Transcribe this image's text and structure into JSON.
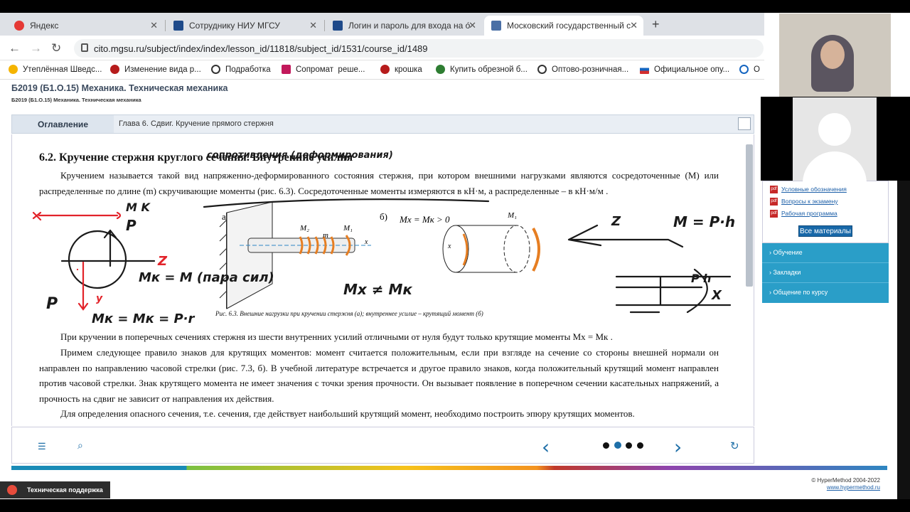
{
  "browser": {
    "tabs": [
      {
        "label": "Яндекс",
        "color": "#e53935"
      },
      {
        "label": "Сотруднику НИУ МГСУ",
        "color": "#1e4a8a"
      },
      {
        "label": "Логин и пароль для входа на о́",
        "color": "#1e4a8a"
      },
      {
        "label": "Московский государственный с",
        "color": "#4a6fa5"
      }
    ],
    "url": "cito.mgsu.ru/subject/index/index/lesson_id/11818/subject_id/1531/course_id/1489",
    "bookmarks": [
      "Утеплённая Шведс...",
      "Изменение вида р...",
      "Подработка",
      "Сопромат ⁣ реше...",
      "крошка",
      "Купить обрезной б...",
      "Оптово-розничная...",
      "Официальное опу...",
      "О"
    ]
  },
  "page": {
    "course_title": "Б2019 (Б1.О.15) Механика. Техническая механика",
    "course_subtitle": "Б2019 (Б1.О.15) Механика. Техническая механика",
    "toc_label": "Оглавление",
    "chapter": "Глава 6. Сдвиг. Кручение прямого стержня",
    "section_heading": "6.2. Кручение стержня круглого сечения. Внутренние усилия",
    "para1": "Кручением называется такой вид напряженно-деформированного состояния стержня, при котором внешними нагрузками являются сосредоточенные (M) или распределенные по длине (m) скручивающие моменты (рис. 6.3). Сосредоточенные моменты измеряются в кН·м, а распределенные – в кН·м/м .",
    "caption": "Рис. 6.3. Внешние нагрузки при кручении стержня (а); внутреннее усилие – крутящий момент (б)",
    "para2": "При кручении в поперечных сечениях стержня из шести внутренних усилий отличными от нуля будут только крутящие моменты Mx = Mк .",
    "para3": "Примем следующее правило знаков для крутящих моментов: момент считается положительным, если при взгляде на сечение со стороны внешней нормали он направлен по направлению часовой стрелки (рис. 7.3, б). В учебной литературе встречается и другое правило знаков, когда положительный крутящий момент направлен против часовой стрелки. Знак крутящего момента не имеет значения с точки зрения прочности. Он вызывает появление в поперечном сечении касательных напряжений, а прочность на сдвиг не зависит от направления их действия.",
    "para4": "Для определения опасного сечения, т.е. сечения, где действует наибольший крутящий момент, необходимо построить эпюру крутящих моментов.",
    "fig_a_label": "а)",
    "fig_b_label": "б)",
    "fig_formula": "Mx = Mк > 0",
    "handwriting": {
      "annot_top": "сопротивления (деформирования)",
      "mk_eq": "Mк = M (пара сил)",
      "mx_neq": "Mx ≠ Mк",
      "mk_eq2": "Mк = Mк = P·r",
      "m_eq": "M = P·h"
    }
  },
  "nav": {
    "dots": 4,
    "active_dot": 1
  },
  "sidebar": {
    "links": [
      "Условные обозначения",
      "Вопросы к экзамену",
      "Рабочая программа"
    ],
    "all_materials": "Все материалы",
    "menu": [
      "Обучение",
      "Закладки",
      "Общение по курсу"
    ]
  },
  "footer": {
    "copyright": "© HyperMethod 2004-2022",
    "site": "www.hypermethod.ru",
    "support": "Техническая поддержка"
  }
}
